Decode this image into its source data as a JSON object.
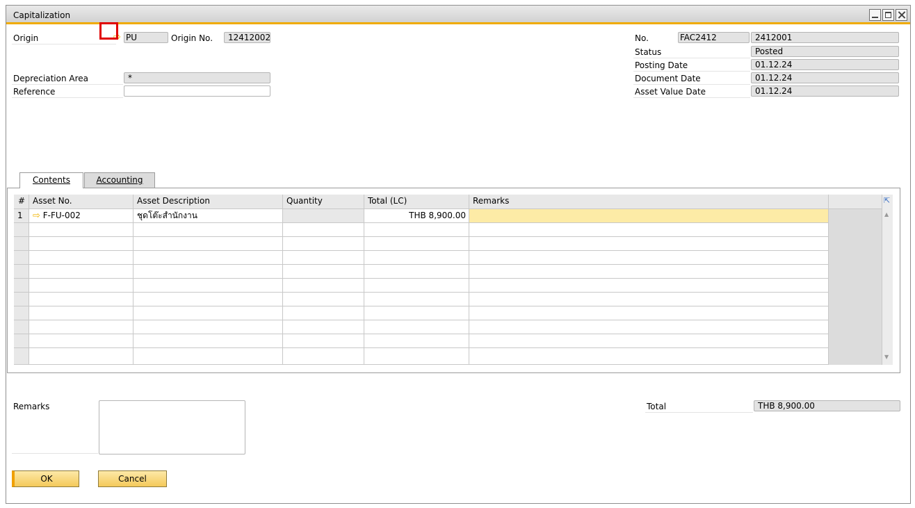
{
  "window": {
    "title": "Capitalization"
  },
  "header": {
    "origin_label": "Origin",
    "origin_value": "PU",
    "origin_no_label": "Origin No.",
    "origin_no_value": "12412002",
    "depreciation_area_label": "Depreciation Area",
    "depreciation_area_value": "*",
    "reference_label": "Reference",
    "reference_value": "",
    "no_label": "No.",
    "series_value": "FAC2412",
    "number_value": "2412001",
    "status_label": "Status",
    "status_value": "Posted",
    "posting_date_label": "Posting Date",
    "posting_date_value": "01.12.24",
    "document_date_label": "Document Date",
    "document_date_value": "01.12.24",
    "asset_value_date_label": "Asset Value Date",
    "asset_value_date_value": "01.12.24"
  },
  "tabs": [
    {
      "label": "Contents",
      "active": true
    },
    {
      "label": "Accounting",
      "active": false
    }
  ],
  "table": {
    "columns": [
      "#",
      "Asset No.",
      "Asset Description",
      "Quantity",
      "Total (LC)",
      "Remarks"
    ],
    "rows": [
      {
        "num": "1",
        "asset_no": "F-FU-002",
        "description": "ชุดโต๊ะสำนักงาน",
        "quantity": "",
        "total": "THB 8,900.00",
        "remarks": ""
      }
    ]
  },
  "footer": {
    "remarks_label": "Remarks",
    "remarks_value": "",
    "total_label": "Total",
    "total_value": "THB 8,900.00"
  },
  "buttons": {
    "ok": "OK",
    "cancel": "Cancel"
  },
  "colors": {
    "accent": "#f0ab00",
    "selected_cell": "#fdeba6",
    "link_arrow": "#f0b400"
  }
}
